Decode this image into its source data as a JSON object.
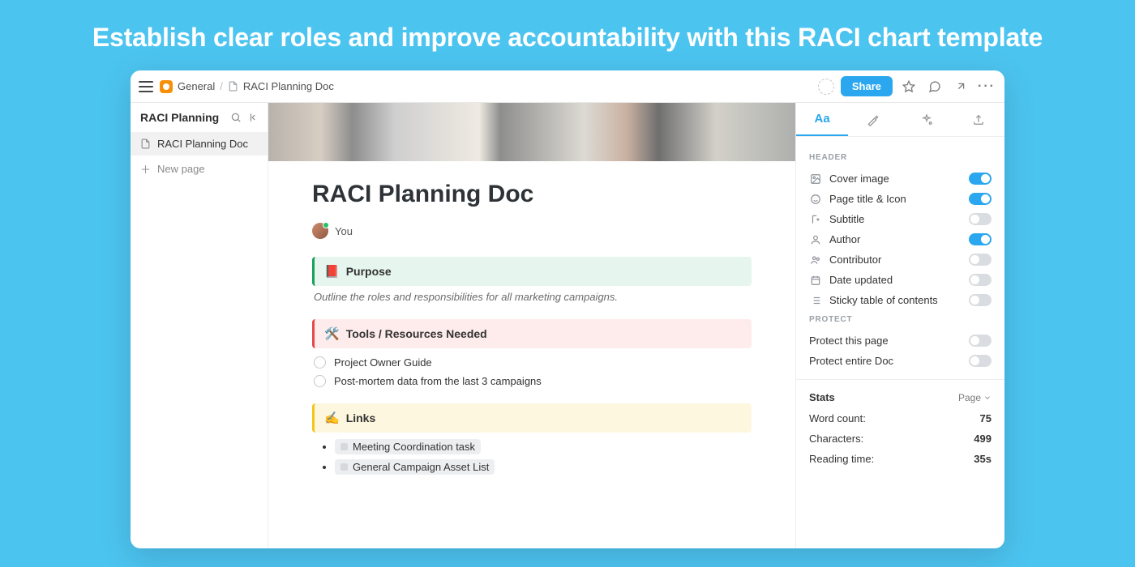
{
  "hero": {
    "title": "Establish clear roles and improve accountability with this RACI chart template"
  },
  "breadcrumb": {
    "workspace": "General",
    "doc": "RACI Planning Doc"
  },
  "topbar": {
    "share": "Share"
  },
  "sidebar": {
    "title": "RACI Planning",
    "doc_item": "RACI Planning Doc",
    "new_page": "New page"
  },
  "doc": {
    "title": "RACI Planning Doc",
    "author": "You",
    "purpose_label": "Purpose",
    "purpose_desc": "Outline the roles and responsibilities for all marketing campaigns.",
    "tools_label": "Tools / Resources Needed",
    "tools_items": [
      "Project Owner Guide",
      "Post-mortem data from the last 3 campaigns"
    ],
    "links_label": "Links",
    "links_items": [
      "Meeting Coordination task",
      "General Campaign Asset List"
    ]
  },
  "panel": {
    "tab_text": "Aa",
    "header_section": "HEADER",
    "options": [
      {
        "label": "Cover image",
        "on": true,
        "icon": "image"
      },
      {
        "label": "Page title & Icon",
        "on": true,
        "icon": "smile"
      },
      {
        "label": "Subtitle",
        "on": false,
        "icon": "subtitle"
      },
      {
        "label": "Author",
        "on": true,
        "icon": "author"
      },
      {
        "label": "Contributor",
        "on": false,
        "icon": "contrib"
      },
      {
        "label": "Date updated",
        "on": false,
        "icon": "date"
      },
      {
        "label": "Sticky table of contents",
        "on": false,
        "icon": "toc"
      }
    ],
    "protect_section": "PROTECT",
    "protect": [
      {
        "label": "Protect this page",
        "on": false
      },
      {
        "label": "Protect entire Doc",
        "on": false
      }
    ],
    "stats_label": "Stats",
    "stats_scope": "Page",
    "stats": [
      {
        "label": "Word count:",
        "value": "75"
      },
      {
        "label": "Characters:",
        "value": "499"
      },
      {
        "label": "Reading time:",
        "value": "35s"
      }
    ]
  }
}
